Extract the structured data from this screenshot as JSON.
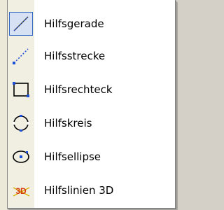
{
  "menu": {
    "items": [
      {
        "label": "Hilfsgerade",
        "icon": "diagonal-line-icon",
        "selected": true
      },
      {
        "label": "Hilfsstrecke",
        "icon": "dashed-segment-icon",
        "selected": false
      },
      {
        "label": "Hilfsrechteck",
        "icon": "rectangle-icon",
        "selected": false
      },
      {
        "label": "Hilfskreis",
        "icon": "dotted-circle-icon",
        "selected": false
      },
      {
        "label": "Hilfsellipse",
        "icon": "ellipse-icon",
        "selected": false
      },
      {
        "label": "Hilfslinien 3D",
        "icon": "3d-lines-icon",
        "selected": false
      }
    ]
  },
  "icon_labels": {
    "three_d": "3D"
  },
  "colors": {
    "menu_background": "#ffffff",
    "gutter": "#f1efe2",
    "highlight_border": "#316ac5",
    "highlight_fill": "#d7e1f4",
    "icon_blue": "#1f4fd6",
    "icon_3d_red": "#d83a10"
  }
}
